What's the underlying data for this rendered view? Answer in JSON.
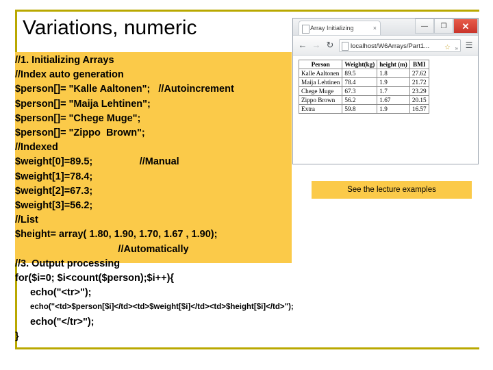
{
  "slide": {
    "title": "Variations, numeric"
  },
  "code": {
    "lines": [
      {
        "text": "//1. Initializing Arrays",
        "size": "normal",
        "indent": 0
      },
      {
        "text": "//Index auto generation",
        "size": "normal",
        "indent": 0
      },
      {
        "text": "$person[]= \"Kalle Aaltonen\";   //Autoincrement",
        "size": "normal",
        "indent": 0
      },
      {
        "text": "$person[]= \"Maija Lehtinen\";",
        "size": "normal",
        "indent": 0
      },
      {
        "text": "$person[]= \"Chege Muge\";",
        "size": "normal",
        "indent": 0
      },
      {
        "text": "$person[]= \"Zippo  Brown\";",
        "size": "normal",
        "indent": 0
      },
      {
        "text": "//Indexed",
        "size": "normal",
        "indent": 0
      },
      {
        "text": "$weight[0]=89.5;                 //Manual",
        "size": "normal",
        "indent": 0
      },
      {
        "text": "$weight[1]=78.4;",
        "size": "normal",
        "indent": 0
      },
      {
        "text": "$weight[2]=67.3;",
        "size": "normal",
        "indent": 0
      },
      {
        "text": "$weight[3]=56.2;",
        "size": "normal",
        "indent": 0
      },
      {
        "text": "//List",
        "size": "normal",
        "indent": 0
      },
      {
        "text": "$height= array( 1.80, 1.90, 1.70, 1.67 , 1.90);",
        "size": "normal",
        "indent": 0
      },
      {
        "text": "//Automatically",
        "size": "normal",
        "indent": 0,
        "center": true
      },
      {
        "text": "//3. Output processing",
        "size": "normal",
        "indent": 0
      },
      {
        "text": "for($i=0; $i<count($person);$i++){",
        "size": "normal",
        "indent": 0
      },
      {
        "text": "echo(\"<tr>\");",
        "size": "normal",
        "indent": 1
      },
      {
        "text": "echo(\"<td>$person[$i]</td><td>$weight[$i]</td><td>$height[$i]</td>\");",
        "size": "small",
        "indent": 1
      },
      {
        "text": "echo(\"</tr>\");",
        "size": "normal",
        "indent": 1
      },
      {
        "text": "}",
        "size": "normal",
        "indent": 0
      }
    ]
  },
  "browser": {
    "tab_title": "Array Initializing",
    "tab_close": "×",
    "window_buttons": {
      "minimize": "—",
      "maximize": "❐",
      "close": "✕"
    },
    "nav": {
      "back": "←",
      "forward": "→",
      "reload": "↻",
      "menu": "☰"
    },
    "url": "localhost/W6Arrays/Part1...",
    "star": "☆",
    "chevron": "»",
    "table": {
      "headers": [
        "Person",
        "Weight(kg)",
        "height (m)",
        "BMI"
      ],
      "rows": [
        [
          "Kalle Aaltonen",
          "89.5",
          "1.8",
          "27.62"
        ],
        [
          "Maija Lehtinen",
          "78.4",
          "1.9",
          "21.72"
        ],
        [
          "Chege Muge",
          "67.3",
          "1.7",
          "23.29"
        ],
        [
          "Zippo Brown",
          "56.2",
          "1.67",
          "20.15"
        ],
        [
          "Extra",
          "59.8",
          "1.9",
          "16.57"
        ]
      ]
    }
  },
  "note": {
    "text": "See the lecture examples"
  }
}
